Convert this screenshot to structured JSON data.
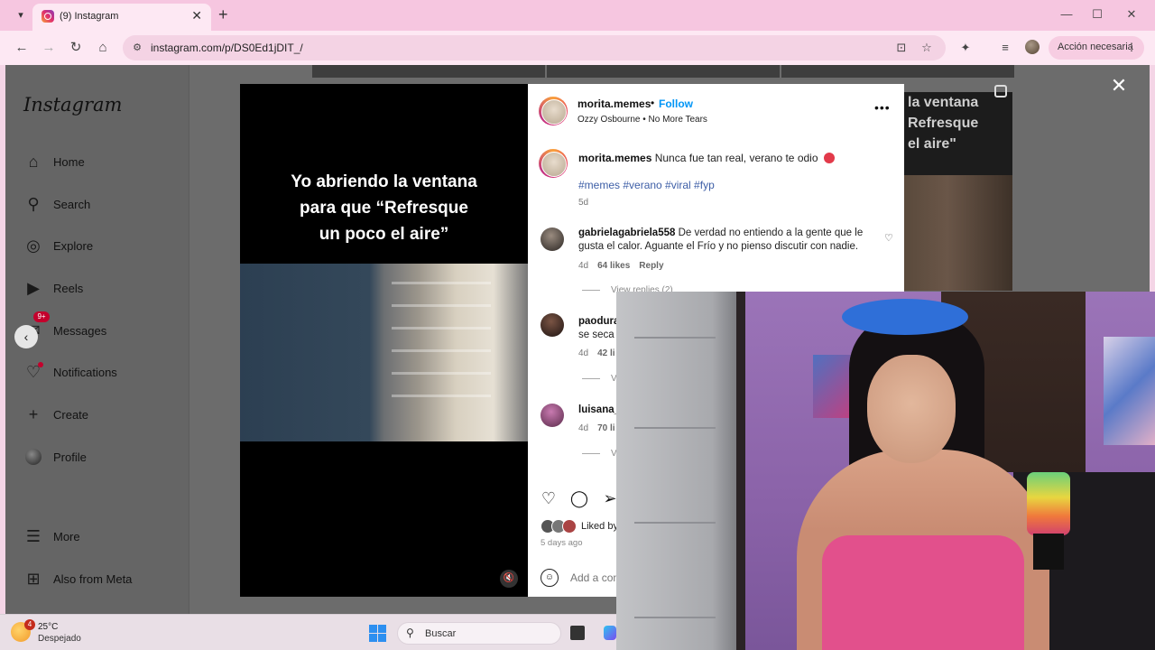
{
  "browser": {
    "tab_title": "(9) Instagram",
    "tab_dropdown_icon": "chevron-down-icon",
    "new_tab_icon": "plus-icon",
    "url": "instagram.com/p/DS0Ed1jDIT_/",
    "action_button_label": "Acción necesaria",
    "window_controls": {
      "minimize": "minimize-icon",
      "maximize": "maximize-icon",
      "close": "close-icon"
    }
  },
  "sidebar": {
    "logo": "Instagram",
    "items": [
      {
        "label": "Home",
        "icon": "home-icon"
      },
      {
        "label": "Search",
        "icon": "search-icon"
      },
      {
        "label": "Explore",
        "icon": "compass-icon"
      },
      {
        "label": "Reels",
        "icon": "reels-icon"
      },
      {
        "label": "Messages",
        "icon": "messenger-icon",
        "badge": "9+"
      },
      {
        "label": "Notifications",
        "icon": "heart-icon"
      },
      {
        "label": "Create",
        "icon": "plus-icon"
      },
      {
        "label": "Profile",
        "icon": "avatar-icon"
      }
    ],
    "bottom_items": [
      {
        "label": "More",
        "icon": "menu-icon"
      },
      {
        "label": "Also from Meta",
        "icon": "meta-icon"
      }
    ]
  },
  "background_post": {
    "caption_lines": [
      "la ventana",
      "Refresque",
      "el aire\""
    ]
  },
  "media": {
    "caption_lines": [
      "Yo abriendo la ventana",
      "para que “Refresque",
      "un poco el aire”"
    ]
  },
  "post": {
    "username": "morita.memes",
    "separator": "•",
    "follow_label": "Follow",
    "audio": "Ozzy Osbourne • No More Tears",
    "caption_user": "morita.memes",
    "caption_text": "Nunca fue tan real, verano te odio",
    "hashtags": "#memes #verano #viral #fyp",
    "age": "5d",
    "comments": [
      {
        "user": "gabrielagabriela558",
        "text": "De verdad no entiendo a la gente que le gusta el calor. Aguante el Frío y no pienso discutir con nadie.",
        "age": "4d",
        "likes": "64 likes",
        "reply": "Reply",
        "view_replies": "View replies (2)"
      },
      {
        "user": "paodura",
        "text": "se seca",
        "age": "4d",
        "likes": "42 li",
        "reply": "",
        "view_replies": "V"
      },
      {
        "user": "luisana_",
        "text": "",
        "age": "4d",
        "likes": "70 li",
        "reply": "",
        "view_replies": "V"
      }
    ],
    "liked_by": "Liked by",
    "date": "5 days ago",
    "add_comment_placeholder": "Add a com"
  },
  "taskbar": {
    "weather_badge": "4",
    "temperature": "25°C",
    "condition": "Despejado",
    "search_placeholder": "Buscar"
  },
  "colors": {
    "tab_bar": "#f6c6e0",
    "follow_blue": "#0095f6",
    "badge_red": "#c4002c",
    "hashtag_blue": "#3d5ea6"
  }
}
